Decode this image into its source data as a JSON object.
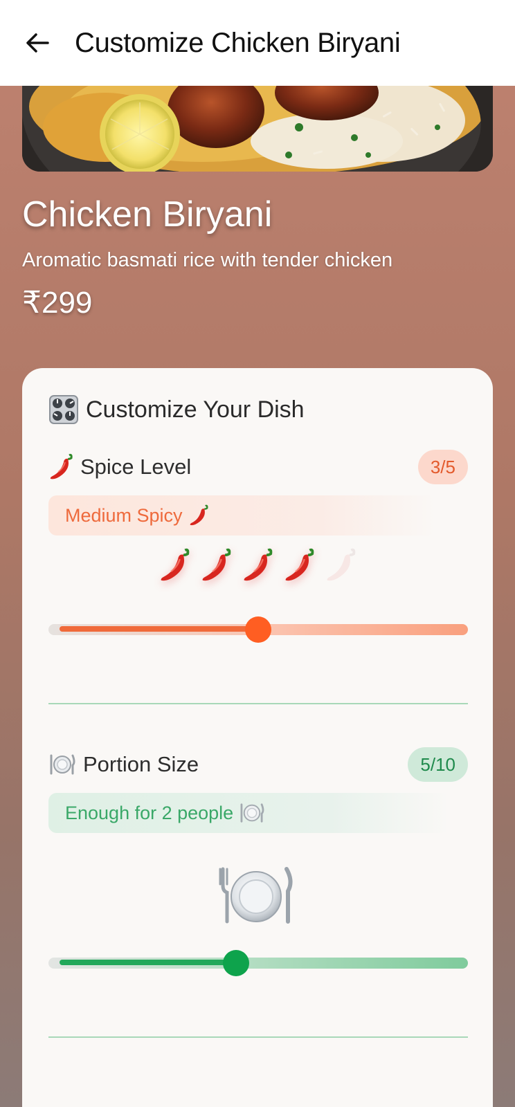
{
  "appbar": {
    "title": "Customize Chicken Biryani",
    "back_icon": "arrow-left-icon"
  },
  "dish": {
    "name": "Chicken Biryani",
    "description": "Aromatic basmati rice with tender chicken",
    "price": "₹299"
  },
  "customize": {
    "title": "Customize Your Dish",
    "title_icon": "control-knobs-icon",
    "spice": {
      "label": "Spice Level",
      "icon": "chili-pepper-icon",
      "badge": "3/5",
      "description": "Medium Spicy",
      "value": 3,
      "max": 5,
      "peppers_lit": 4,
      "slider_fraction": 0.5,
      "accent": "#ff6a2c"
    },
    "portion": {
      "label": "Portion Size",
      "icon": "plate-icon",
      "badge": "5/10",
      "description": "Enough for 2 people",
      "value": 5,
      "max": 10,
      "slider_fraction": 0.444,
      "accent": "#0fa24a"
    }
  }
}
